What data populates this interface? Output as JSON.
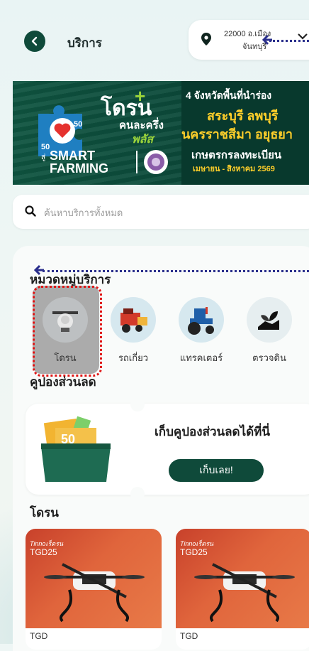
{
  "header": {
    "title": "บริการ",
    "location_line1": "22000 อ.เมือง",
    "location_line2": "จันทบุรี"
  },
  "banner": {
    "brand": "โดรน",
    "brand_sub": "คนละครึ่ง",
    "brand_plus": "พลัส",
    "badge_value": "50",
    "smart_prefix": "สู่",
    "smart_line1": "SMART",
    "smart_line2": "FARMING",
    "line1": "4 จังหวัดพื้นที่นำร่อง",
    "line2": "สระบุรี ลพบุรี",
    "line3": "นครราชสีมา อยุธยา",
    "line4": "เกษตรกรลงทะเบียน",
    "line5": "เมษายน - สิงหาคม 2569"
  },
  "search": {
    "placeholder": "ค้นหาบริการทั้งหมด"
  },
  "categories": {
    "title": "หมวดหมู่บริการ",
    "items": [
      {
        "label": "โดรน",
        "icon": "drone-icon"
      },
      {
        "label": "รถเกี่ยว",
        "icon": "harvester-icon"
      },
      {
        "label": "แทรคเตอร์",
        "icon": "tractor-icon"
      },
      {
        "label": "ตรวจดิน",
        "icon": "soil-test-icon"
      }
    ]
  },
  "coupons": {
    "title": "คูปองส่วนลด",
    "text": "เก็บคูปองส่วนลดได้ที่นี่",
    "button": "เก็บเลย!",
    "art_value": "50"
  },
  "products": {
    "title": "โดรน",
    "items": [
      {
        "brand": "Tinnoเร็ดรน",
        "model": "TGD25",
        "name": "TGD"
      },
      {
        "brand": "Tinnoเร็ดรน",
        "model": "TGD25",
        "name": "TGD"
      }
    ]
  },
  "colors": {
    "brand_green": "#0f4a3a",
    "accent_yellow": "#ffcf2a",
    "highlight_red": "#e01414",
    "annotation_blue": "#2a2f8c"
  }
}
